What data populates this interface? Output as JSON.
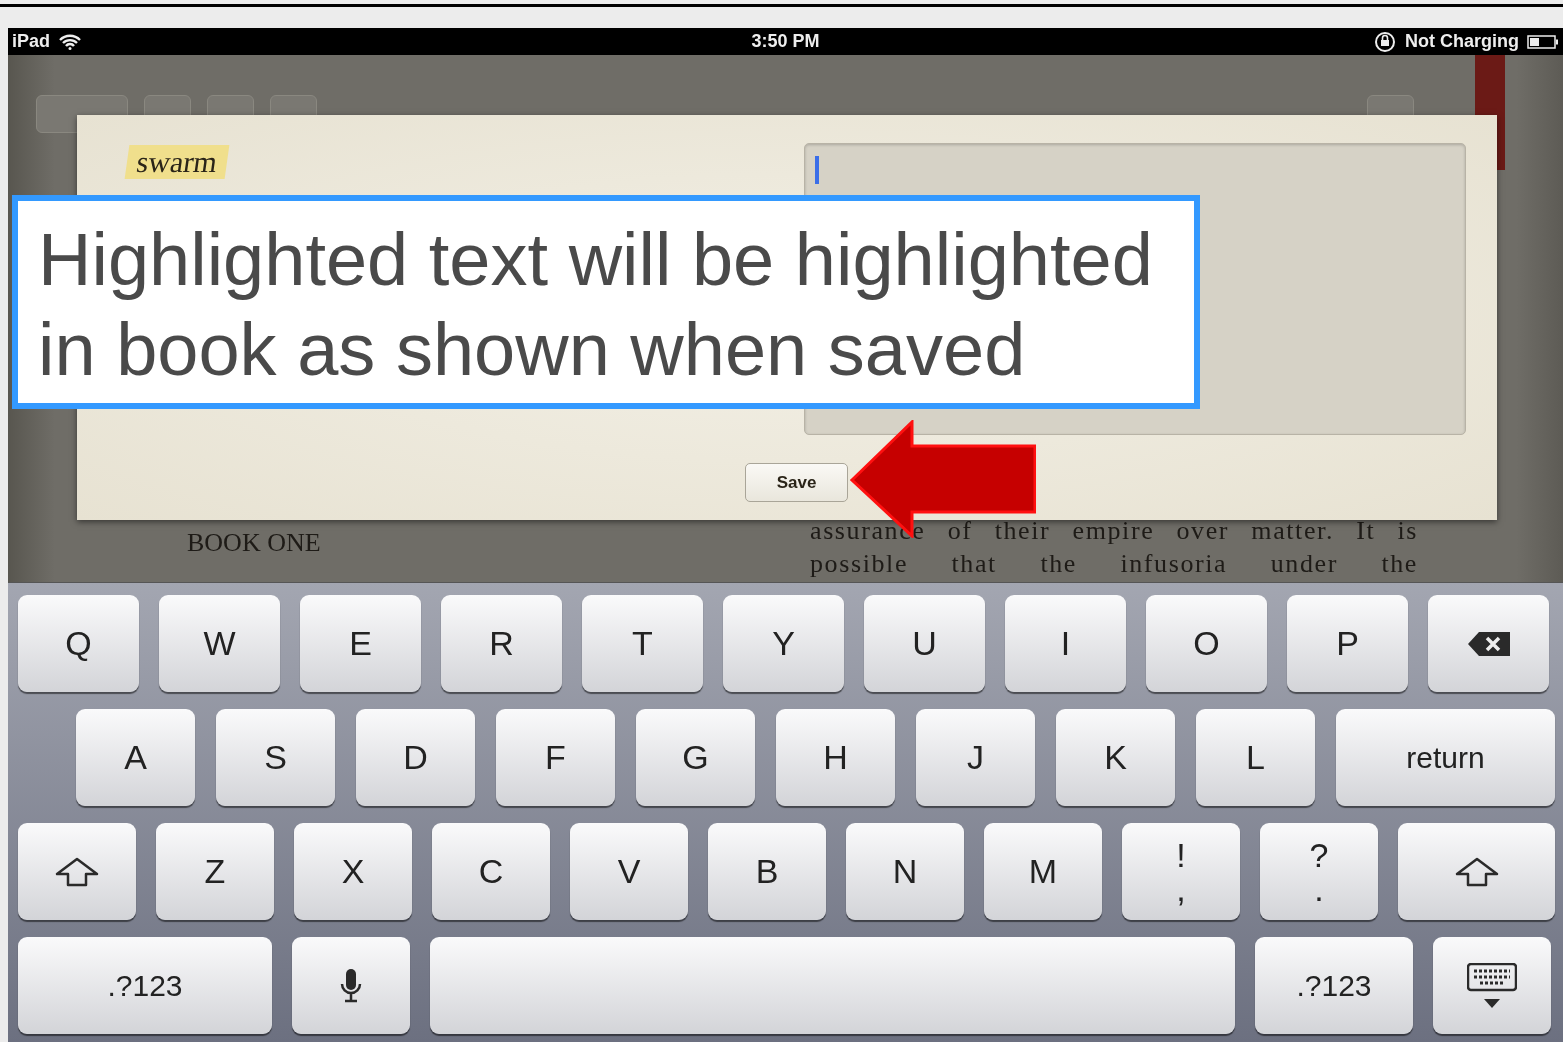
{
  "status_bar": {
    "device": "iPad",
    "time": "3:50 PM",
    "charging": "Not Charging"
  },
  "note_dialog": {
    "highlighted_word": "swarm",
    "save_button": "Save"
  },
  "book_page": {
    "chapter": "BOOK ONE",
    "lines": [
      "assurance of their empire over matter. It is",
      "possible that the infusoria under the"
    ]
  },
  "callout": {
    "text": "Highlighted text will be highlighted in book as shown when saved"
  },
  "keyboard": {
    "rows": [
      {
        "keys": [
          {
            "label": "Q",
            "kind": "letter"
          },
          {
            "label": "W",
            "kind": "letter"
          },
          {
            "label": "E",
            "kind": "letter"
          },
          {
            "label": "R",
            "kind": "letter"
          },
          {
            "label": "T",
            "kind": "letter"
          },
          {
            "label": "Y",
            "kind": "letter"
          },
          {
            "label": "U",
            "kind": "letter"
          },
          {
            "label": "I",
            "kind": "letter"
          },
          {
            "label": "O",
            "kind": "letter"
          },
          {
            "label": "P",
            "kind": "letter"
          },
          {
            "kind": "delete"
          }
        ]
      },
      {
        "keys": [
          {
            "label": "A",
            "kind": "letter"
          },
          {
            "label": "S",
            "kind": "letter"
          },
          {
            "label": "D",
            "kind": "letter"
          },
          {
            "label": "F",
            "kind": "letter"
          },
          {
            "label": "G",
            "kind": "letter"
          },
          {
            "label": "H",
            "kind": "letter"
          },
          {
            "label": "J",
            "kind": "letter"
          },
          {
            "label": "K",
            "kind": "letter"
          },
          {
            "label": "L",
            "kind": "letter"
          },
          {
            "label": "return",
            "kind": "return"
          }
        ]
      },
      {
        "keys": [
          {
            "kind": "shift"
          },
          {
            "label": "Z",
            "kind": "letter"
          },
          {
            "label": "X",
            "kind": "letter"
          },
          {
            "label": "C",
            "kind": "letter"
          },
          {
            "label": "V",
            "kind": "letter"
          },
          {
            "label": "B",
            "kind": "letter"
          },
          {
            "label": "N",
            "kind": "letter"
          },
          {
            "label": "M",
            "kind": "letter"
          },
          {
            "label": "!",
            "sub": ",",
            "kind": "dual"
          },
          {
            "label": "?",
            "sub": ".",
            "kind": "dual"
          },
          {
            "kind": "shift"
          }
        ]
      },
      {
        "keys": [
          {
            "label": ".?123",
            "kind": "numbers"
          },
          {
            "kind": "mic"
          },
          {
            "kind": "space"
          },
          {
            "label": ".?123",
            "kind": "numbers"
          },
          {
            "kind": "hide"
          }
        ]
      }
    ]
  }
}
